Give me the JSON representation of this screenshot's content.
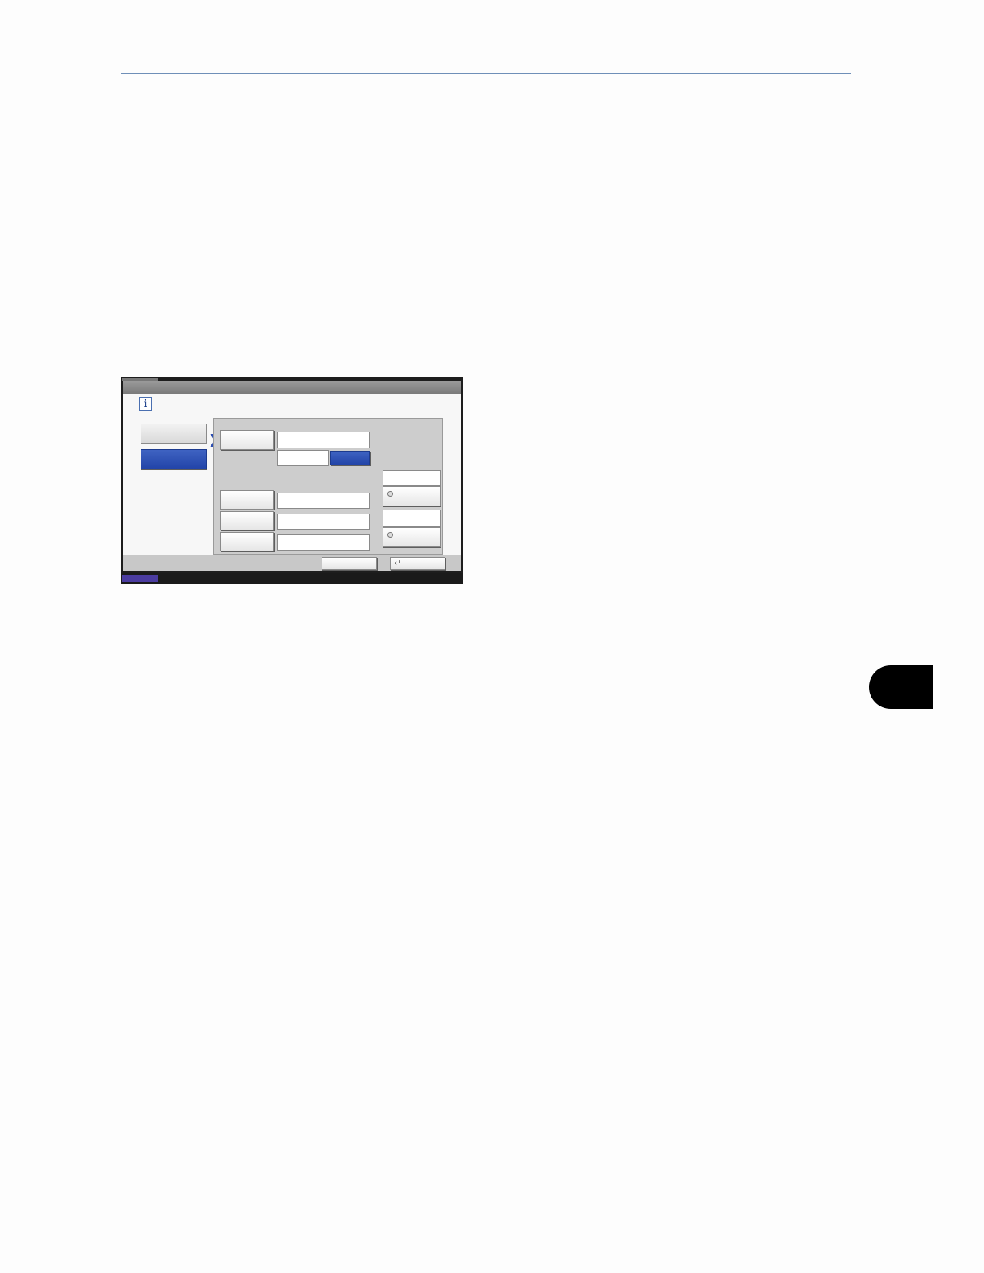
{
  "page": {
    "chapter_tab_color": "#000000",
    "rule_color": "#6f8fb8",
    "link_underline_color": "#2f56b8"
  },
  "screen": {
    "info_icon_glyph": "i",
    "chevron_glyph": "❯",
    "enter_glyph": "↵",
    "accent_color": "#2c4db0",
    "status_indicator_color": "#4b3ca0"
  }
}
